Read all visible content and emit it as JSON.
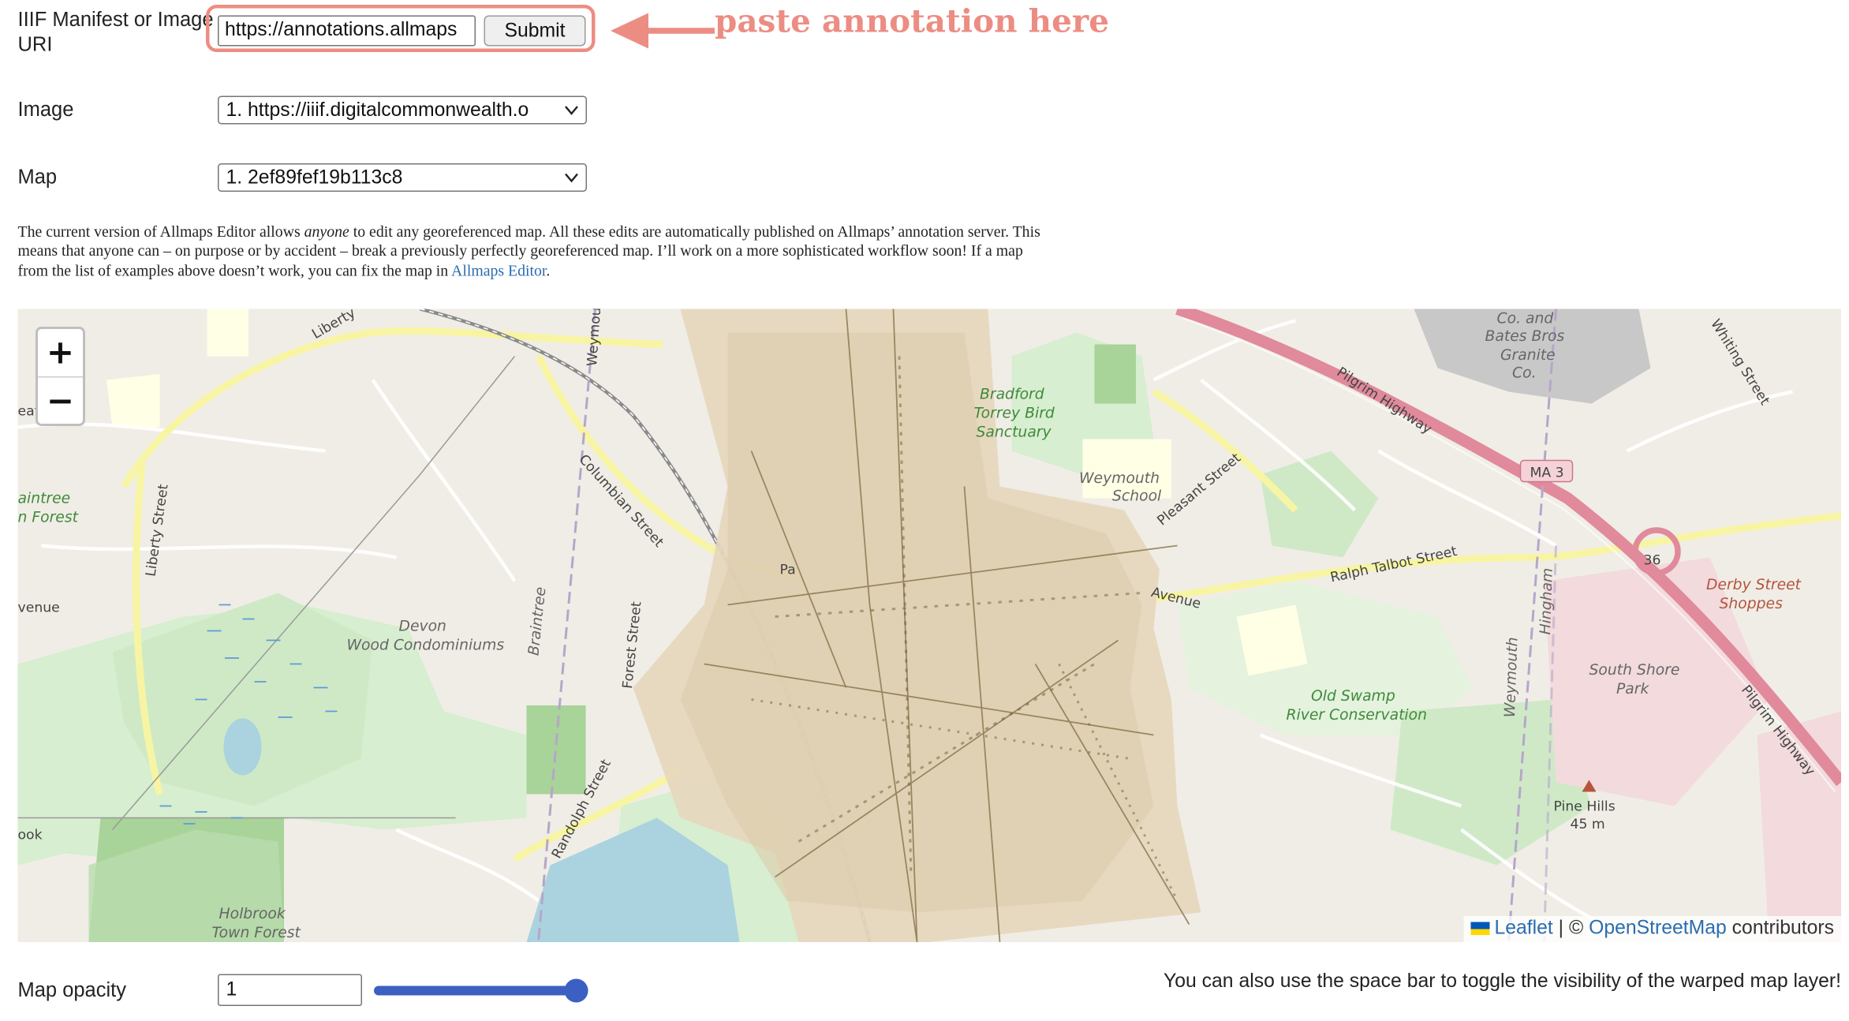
{
  "form": {
    "uri_label": "IIIF Manifest or Image URI",
    "uri_value": "https://annotations.allmaps",
    "submit_label": "Submit",
    "annotation_hint": "paste annotation here",
    "image_label": "Image",
    "image_selected": "1. https://iiif.digitalcommonwealth.o",
    "map_label": "Map",
    "map_selected": "1. 2ef89fef19b113c8"
  },
  "notice": {
    "part1": "The current version of Allmaps Editor allows ",
    "emphasis": "anyone",
    "part2": " to edit any georeferenced map. All these edits are automatically published on Allmaps’ annotation server. This means that anyone can – on purpose or by accident – break a previously perfectly georeferenced map. I’ll work on a more sophisticated workflow soon! If a map from the list of examples above doesn’t work, you can fix the map in ",
    "link": "Allmaps Editor",
    "part3": "."
  },
  "map": {
    "zoom_in": "+",
    "zoom_out": "−",
    "attribution": {
      "leaflet": "Leaflet",
      "separator": " | © ",
      "osm": "OpenStreetMap",
      "suffix": " contributors"
    },
    "labels": {
      "bradford_1": "Bradford",
      "bradford_2": "Torrey Bird",
      "bradford_3": "Sanctuary",
      "weymouth_school_1": "Weymouth",
      "weymouth_school_2": "School",
      "devon_1": "Devon",
      "devon_2": "Wood Condominiums",
      "bates_1": "Co. and",
      "bates_2": "Bates Bros",
      "bates_3": "Granite",
      "bates_4": "Co.",
      "old_swamp_1": "Old Swamp",
      "old_swamp_2": "River Conservation",
      "derby_1": "Derby Street",
      "derby_2": "Shoppes",
      "south_shore_1": "South Shore",
      "south_shore_2": "Park",
      "pine_hills_1": "Pine Hills",
      "pine_hills_2": "45 m",
      "holbrook_1": "Holbrook",
      "holbrook_2": "Town Forest",
      "braintree_1": "aintree",
      "braintree_2": "n Forest",
      "pilgrim_hwy_1": "Pilgrim Highway",
      "pilgrim_hwy_2": "Pilgrim Highway",
      "ma3": "MA 3",
      "exit36": "36",
      "ralph_talbot": "Ralph Talbot Street",
      "avenue": "Avenue",
      "columbian": "Columbian Street",
      "liberty_street": "Liberty Street",
      "liberty": "Liberty",
      "forest_street": "Forest Street",
      "randolph": "Randolph Street",
      "braintree_road": "Braintree",
      "weymouth_road": "Weymouth",
      "hingham": "Hingham",
      "whiting": "Whiting Street",
      "pleasant": "Pleasant Street",
      "venue": "venue",
      "eat": "eat",
      "ook": "ook",
      "weymou": "Weymou",
      "pa": "Pa"
    }
  },
  "controls": {
    "opacity_label": "Map opacity",
    "opacity_value": "1",
    "opacity_slider_level": 1.0,
    "space_bar_hint": "You can also use the space bar to toggle the visibility of the warped map layer!"
  },
  "colors": {
    "accent": "#ec8d83",
    "link": "#2b6cb0",
    "slider": "#3c5fc2",
    "highway": "#e08a9c"
  }
}
